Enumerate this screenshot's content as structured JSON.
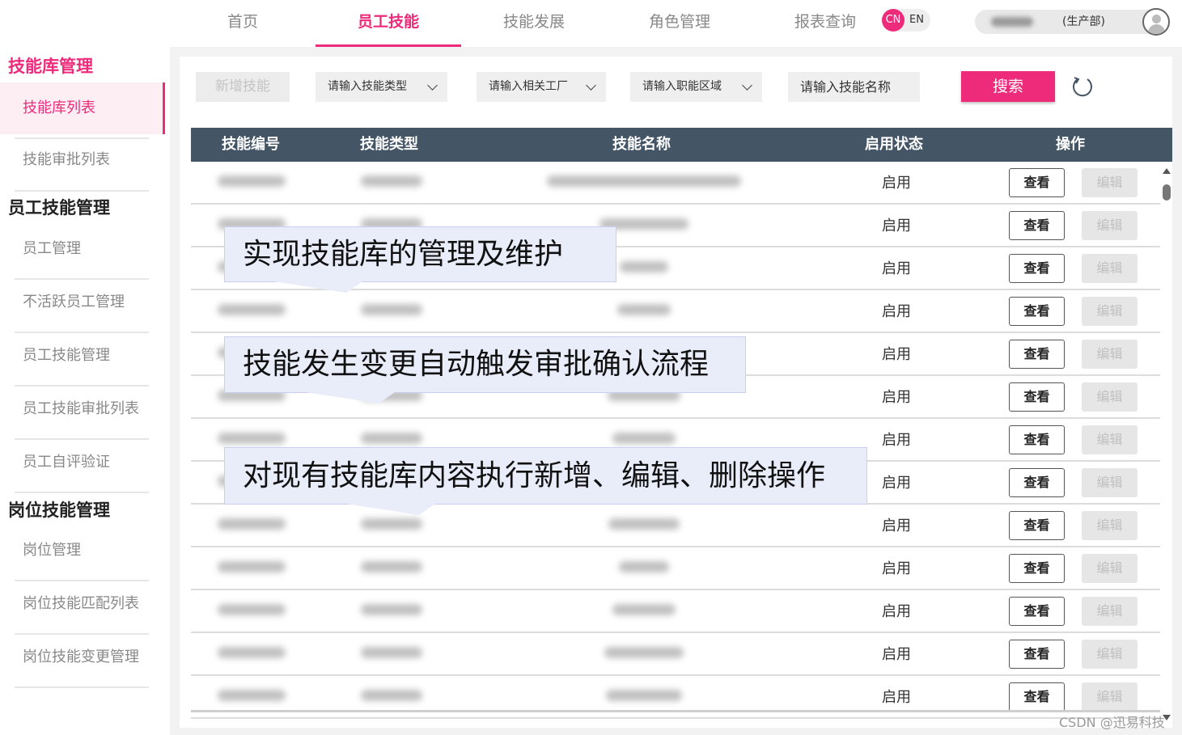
{
  "topnav": {
    "tabs": [
      "首页",
      "员工技能",
      "技能发展",
      "角色管理",
      "报表查询"
    ],
    "active_tab": 1,
    "lang_cn": "CN",
    "lang_en": "EN",
    "user_dept": "(生产部)"
  },
  "sidebar": {
    "groups": [
      {
        "title": "技能库管理",
        "items": [
          "技能库列表",
          "技能审批列表"
        ]
      },
      {
        "title": "员工技能管理",
        "items": [
          "员工管理",
          "不活跃员工管理",
          "员工技能管理",
          "员工技能审批列表",
          "员工自评验证"
        ]
      },
      {
        "title": "岗位技能管理",
        "items": [
          "岗位管理",
          "岗位技能匹配列表",
          "岗位技能变更管理"
        ]
      }
    ],
    "active_item": "技能库列表"
  },
  "toolbar": {
    "add_label": "新增技能",
    "type_select": "请输入技能类型",
    "factory_select": "请输入相关工厂",
    "area_select": "请输入职能区域",
    "name_placeholder": "请输入技能名称",
    "search_label": "搜索"
  },
  "table": {
    "headers": [
      "技能编号",
      "技能类型",
      "技能名称",
      "启用状态",
      "操作"
    ],
    "rows": [
      {
        "status": "启用",
        "view": "查看",
        "edit": "编辑"
      },
      {
        "status": "启用",
        "view": "查看",
        "edit": "编辑"
      },
      {
        "status": "启用",
        "view": "查看",
        "edit": "编辑"
      },
      {
        "status": "启用",
        "view": "查看",
        "edit": "编辑"
      },
      {
        "status": "启用",
        "view": "查看",
        "edit": "编辑"
      },
      {
        "status": "启用",
        "view": "查看",
        "edit": "编辑"
      },
      {
        "status": "启用",
        "view": "查看",
        "edit": "编辑"
      },
      {
        "status": "启用",
        "view": "查看",
        "edit": "编辑"
      },
      {
        "status": "启用",
        "view": "查看",
        "edit": "编辑"
      },
      {
        "status": "启用",
        "view": "查看",
        "edit": "编辑"
      },
      {
        "status": "启用",
        "view": "查看",
        "edit": "编辑"
      },
      {
        "status": "启用",
        "view": "查看",
        "edit": "编辑"
      },
      {
        "status": "启用",
        "view": "查看",
        "edit": "编辑"
      }
    ]
  },
  "callouts": [
    "实现技能库的管理及维护",
    "技能发生变更自动触发审批确认流程",
    "对现有技能库内容执行新增、编辑、删除操作"
  ],
  "watermark": "CSDN @迅易科技",
  "colors": {
    "accent": "#ee2b7b",
    "table_header": "#445566",
    "callout_bg": "#e9ecf9"
  },
  "icons": {
    "refresh": "refresh-icon",
    "avatar": "user-avatar-icon",
    "dropdown": "chevron-down-icon"
  }
}
